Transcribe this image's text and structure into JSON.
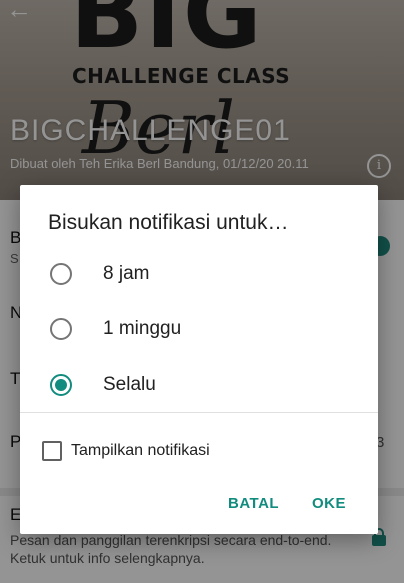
{
  "header": {
    "logo_big": "BIG",
    "logo_sub": "CHALLENGE CLASS",
    "logo_script": "Berl",
    "group_name": "BIGCHALLENGE01",
    "created_by": "Dibuat oleh Teh Erika Berl Bandung, 01/12/20 20.11",
    "info_icon": "i"
  },
  "list_partial": {
    "row1_letter": "B",
    "row1_sub": "S",
    "row2_letter": "N",
    "row3_letter": "T",
    "row4_letter": "P",
    "row4_count": "3",
    "row5_letter": "E",
    "encryption_text": "Pesan dan panggilan terenkripsi secara end-to-end. Ketuk untuk info selengkapnya."
  },
  "dialog": {
    "title": "Bisukan notifikasi untuk…",
    "options": [
      {
        "label": "8 jam",
        "selected": false
      },
      {
        "label": "1 minggu",
        "selected": false
      },
      {
        "label": "Selalu",
        "selected": true
      }
    ],
    "show_notifications_label": "Tampilkan notifikasi",
    "show_notifications_checked": false,
    "cancel_label": "BATAL",
    "ok_label": "OKE"
  },
  "colors": {
    "accent": "#128c7e",
    "scrim": "rgba(0,0,0,0.42)"
  },
  "icons": [
    "back-arrow-icon",
    "info-icon",
    "lock-icon"
  ]
}
